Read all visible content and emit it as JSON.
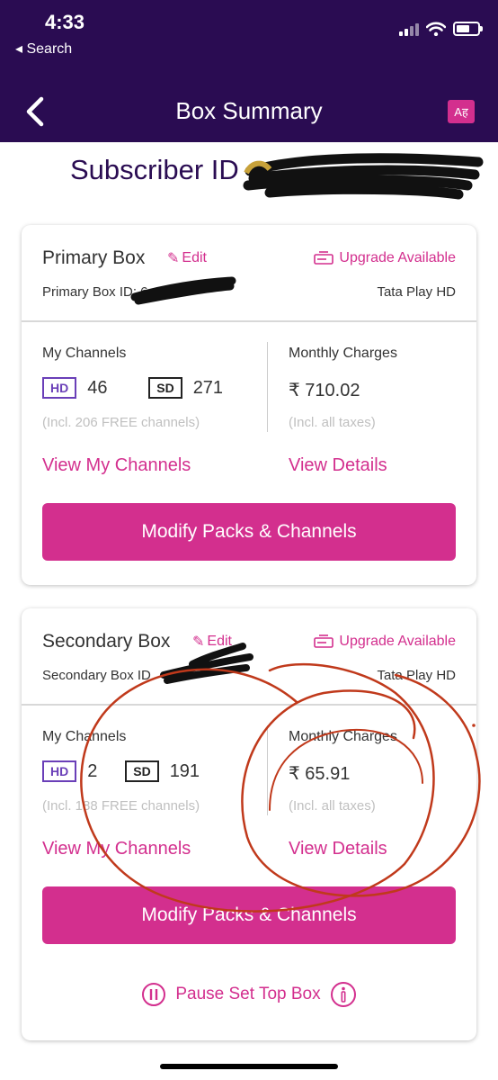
{
  "status_bar": {
    "time": "4:33",
    "back_label": "Search"
  },
  "nav": {
    "title": "Box Summary",
    "lang_label": "Aह"
  },
  "subscriber": {
    "label": "Subscriber ID"
  },
  "boxes": [
    {
      "name": "Primary Box",
      "edit": "Edit",
      "upgrade": "Upgrade Available",
      "id_label": "Primary Box ID: 6",
      "type": "Tata Play HD",
      "my_channels_label": "My Channels",
      "hd_tag": "HD",
      "hd_count": "46",
      "sd_tag": "SD",
      "sd_count": "271",
      "free_note": "(Incl. 206 FREE channels)",
      "charges_label": "Monthly Charges",
      "charges_amount": "₹ 710.02",
      "tax_note": "(Incl. all taxes)",
      "view_channels": "View My Channels",
      "view_details": "View Details",
      "modify": "Modify Packs & Channels"
    },
    {
      "name": "Secondary Box",
      "edit": "Edit",
      "upgrade": "Upgrade Available",
      "id_label": "Secondary Box ID",
      "type": "Tata Play HD",
      "my_channels_label": "My Channels",
      "hd_tag": "HD",
      "hd_count": "2",
      "sd_tag": "SD",
      "sd_count": "191",
      "free_note": "(Incl. 188 FREE channels)",
      "charges_label": "Monthly Charges",
      "charges_amount": "₹ 65.91",
      "tax_note": "(Incl. all taxes)",
      "view_channels": "View My Channels",
      "view_details": "View Details",
      "modify": "Modify Packs & Channels"
    }
  ],
  "pause": {
    "label": "Pause Set Top Box"
  },
  "colors": {
    "header": "#2a0c52",
    "accent": "#d32f8e",
    "annotation": "#c0391b"
  }
}
